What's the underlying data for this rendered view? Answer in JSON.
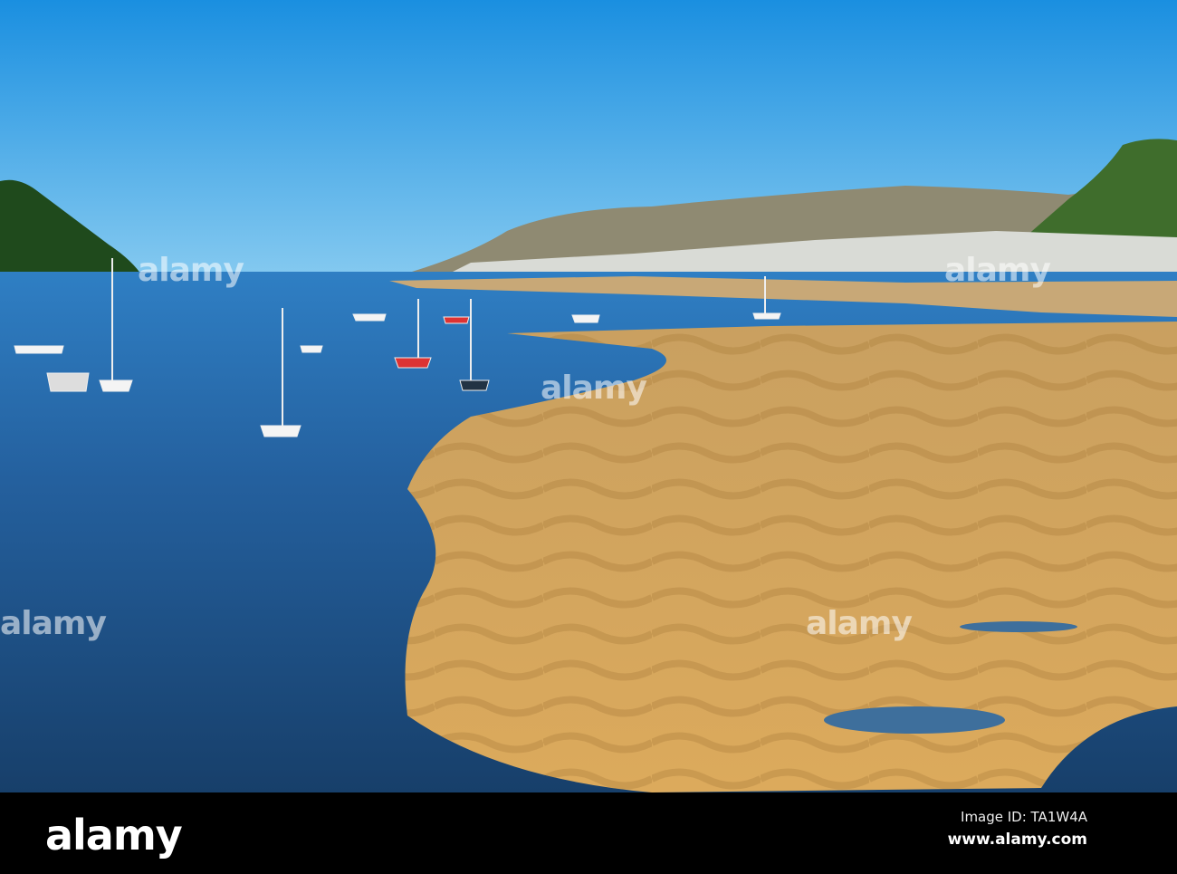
{
  "photo": {
    "subject": "Conwy estuary at low tide with moored sailboats and sand bank"
  },
  "watermark": {
    "logo": "alamy"
  },
  "footer": {
    "logo": "alamy",
    "image_id": "Image ID: TA1W4A",
    "url": "www.alamy.com"
  },
  "colors": {
    "sky_top": "#1a8fe0",
    "sky_bottom": "#7cc6f0",
    "water": "#1f4f86",
    "sand": "#d6a85c"
  }
}
